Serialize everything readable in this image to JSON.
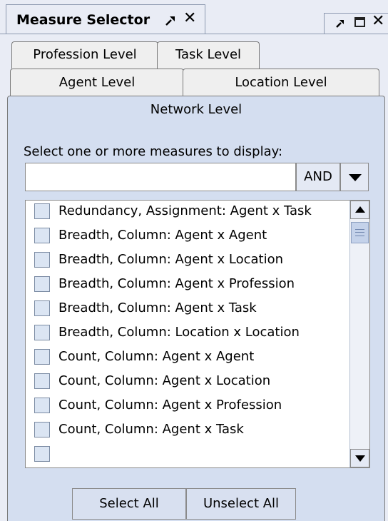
{
  "window": {
    "title": "Measure Selector"
  },
  "tabs": [
    {
      "label": "Profession Level"
    },
    {
      "label": "Task Level"
    },
    {
      "label": "Agent Level"
    },
    {
      "label": "Location Level"
    },
    {
      "label": "Network Level"
    }
  ],
  "prompt": "Select one or more measures to display:",
  "search": {
    "value": "",
    "operator": "AND"
  },
  "measures": [
    {
      "label": "Redundancy, Assignment: Agent x Task",
      "checked": false
    },
    {
      "label": "Breadth, Column: Agent x Agent",
      "checked": false
    },
    {
      "label": "Breadth, Column: Agent x Location",
      "checked": false
    },
    {
      "label": "Breadth, Column: Agent x Profession",
      "checked": false
    },
    {
      "label": "Breadth, Column: Agent x Task",
      "checked": false
    },
    {
      "label": "Breadth, Column: Location x Location",
      "checked": false
    },
    {
      "label": "Count, Column: Agent x Agent",
      "checked": false
    },
    {
      "label": "Count, Column: Agent x Location",
      "checked": false
    },
    {
      "label": "Count, Column: Agent x Profession",
      "checked": false
    },
    {
      "label": "Count, Column: Agent x Task",
      "checked": false
    }
  ],
  "buttons": {
    "select_all": "Select All",
    "unselect_all": "Unselect All"
  },
  "icons": {
    "pin": "pin-icon",
    "close": "close-icon",
    "maximize": "maximize-icon"
  },
  "colors": {
    "panel": "#d4def0",
    "checkbox": "#dbe5f3"
  }
}
